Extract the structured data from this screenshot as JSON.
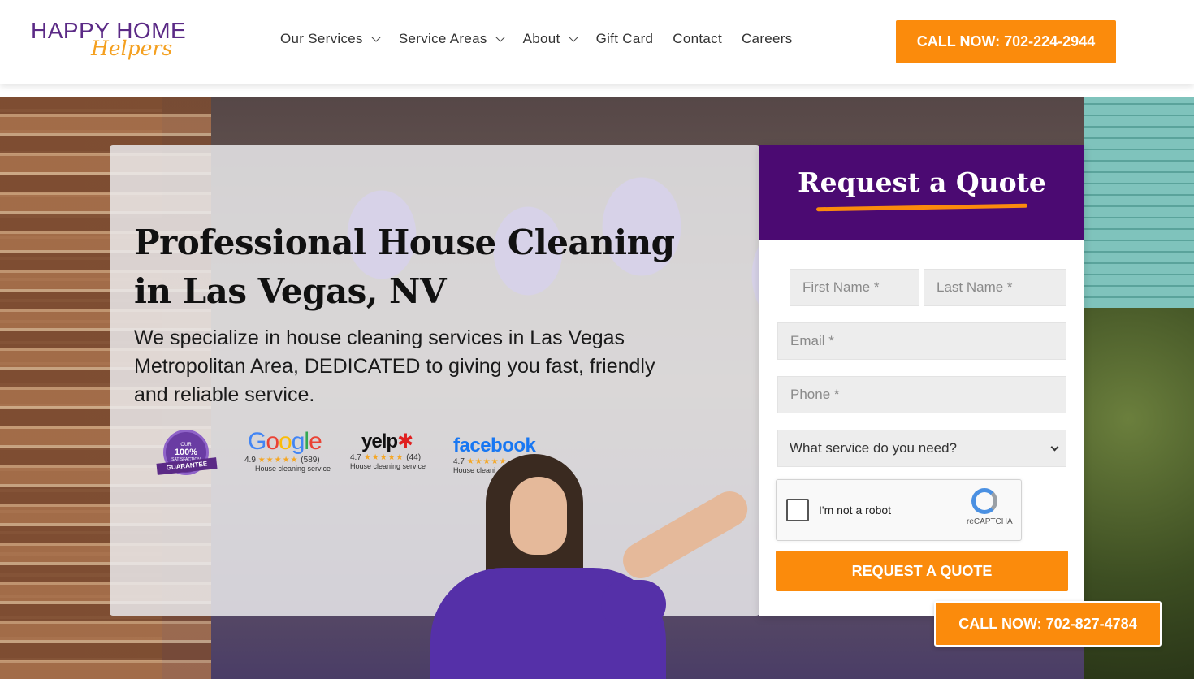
{
  "header": {
    "logo_top": "HAPPY HOME",
    "logo_script": "Helpers",
    "nav": [
      {
        "label": "Our Services",
        "dropdown": true
      },
      {
        "label": "Service Areas",
        "dropdown": true
      },
      {
        "label": "About",
        "dropdown": true
      },
      {
        "label": "Gift Card",
        "dropdown": false
      },
      {
        "label": "Contact",
        "dropdown": false
      },
      {
        "label": "Careers",
        "dropdown": false
      }
    ],
    "call_label": "CALL NOW: 702-224-2944"
  },
  "hero": {
    "title_line1": "Professional House Cleaning",
    "title_line2": "in Las Vegas, NV",
    "subtitle": "We specialize in house cleaning services in Las Vegas Metropolitan Area, DEDICATED to giving you fast, friendly and reliable service."
  },
  "badges": {
    "guarantee": {
      "top": "OUR",
      "pct": "100%",
      "sat": "SATISFACTION",
      "ribbon": "GUARANTEE"
    },
    "google": {
      "brand_letters": [
        "G",
        "o",
        "o",
        "g",
        "l",
        "e"
      ],
      "rating": "4.9",
      "stars": "★★★★★",
      "count": "(589)",
      "caption": "House cleaning service"
    },
    "yelp": {
      "brand": "yelp",
      "rating": "4.7",
      "stars": "★★★★★",
      "count": "(44)",
      "caption": "House cleaning service"
    },
    "facebook": {
      "brand": "facebook",
      "rating": "4.7",
      "stars": "★★★★★",
      "caption": "House cleani"
    }
  },
  "quote": {
    "title": "Request a Quote",
    "first_name_placeholder": "First Name *",
    "last_name_placeholder": "Last Name *",
    "email_placeholder": "Email *",
    "phone_placeholder": "Phone *",
    "service_select": "What service do you need?",
    "captcha_label": "I'm not a robot",
    "captcha_brand": "reCAPTCHA",
    "submit_label": "REQUEST A QUOTE"
  },
  "floating_call": "CALL NOW: 702-827-4784",
  "colors": {
    "brand_purple": "#4b0a72",
    "accent_orange": "#fb8b0c"
  },
  "icons": {
    "chevron": "chevron-down-icon",
    "recaptcha": "recaptcha-icon"
  }
}
